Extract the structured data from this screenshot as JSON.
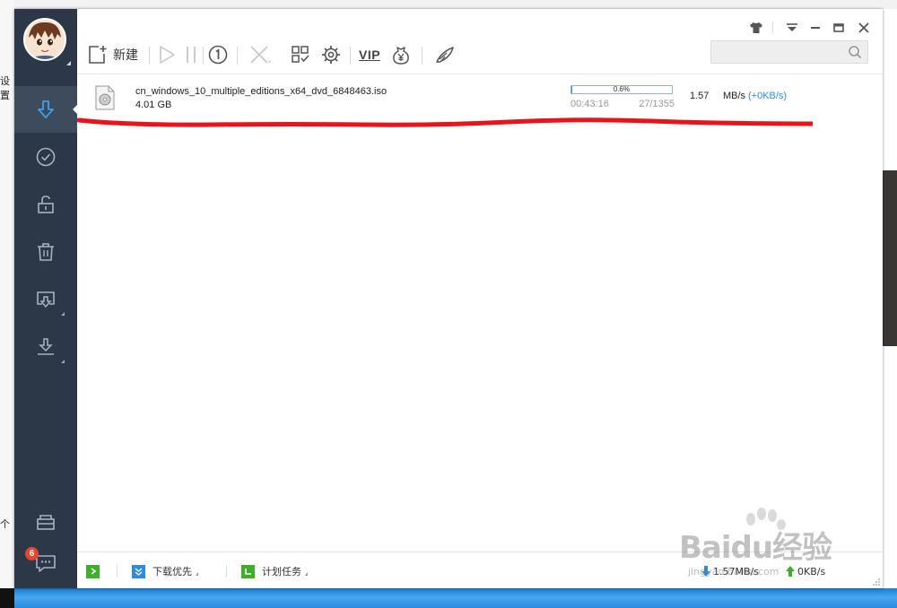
{
  "desktop": {
    "left_fragment_1": "设置",
    "left_fragment_2": "个"
  },
  "window": {
    "toolbar": {
      "new_label": "新建",
      "vip_label": "VIP",
      "search_placeholder": ""
    },
    "sidebar": {
      "badge_count": "6"
    },
    "task": {
      "filename": "cn_windows_10_multiple_editions_x64_dvd_6848463.iso",
      "size": "4.01 GB",
      "progress_text": "0.6%",
      "progress_value": 0.006,
      "elapsed": "00:43:16",
      "pieces": "27/1355",
      "speed": "1.57",
      "speed_unit": "MB/s",
      "upload": "(+0KB/s)"
    },
    "statusbar": {
      "priority_label": "下载优先",
      "schedule_label": "计划任务",
      "download_speed": "1.57MB/s",
      "upload_speed": "0KB/s"
    }
  },
  "watermark": {
    "brand": "Baidu经验",
    "url": "jingyan.baidu.com"
  },
  "colors": {
    "sidebar": "#2c3847",
    "sidebar_active": "#3d4b5c",
    "accent_blue": "#2f8be0",
    "annotation_red": "#e8141b",
    "green": "#3fae2a"
  }
}
